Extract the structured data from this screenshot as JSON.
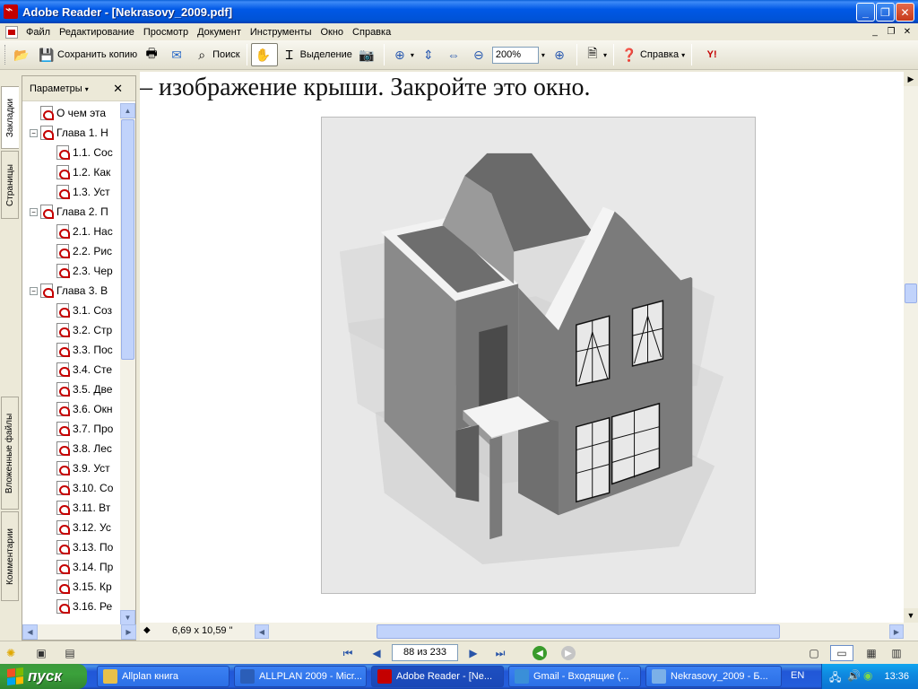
{
  "window": {
    "title": "Adobe Reader - [Nekrasovy_2009.pdf]"
  },
  "menu": {
    "items": [
      "Файл",
      "Редактирование",
      "Просмотр",
      "Документ",
      "Инструменты",
      "Окно",
      "Справка"
    ]
  },
  "toolbar": {
    "save_copy": "Сохранить копию",
    "search": "Поиск",
    "select": "Выделение",
    "zoom_value": "200%",
    "help": "Справка"
  },
  "side_tabs": {
    "bookmarks": "Закладки",
    "pages": "Страницы",
    "attachments": "Вложенные файлы",
    "comments": "Комментарии"
  },
  "bookmarks_panel": {
    "options_label": "Параметры",
    "items": [
      {
        "label": "О чем эта",
        "level": 0,
        "expander": ""
      },
      {
        "label": "Глава 1. Н",
        "level": 0,
        "expander": "−"
      },
      {
        "label": "1.1. Сос",
        "level": 1,
        "expander": ""
      },
      {
        "label": "1.2. Как",
        "level": 1,
        "expander": ""
      },
      {
        "label": "1.3. Уст",
        "level": 1,
        "expander": ""
      },
      {
        "label": "Глава 2. П",
        "level": 0,
        "expander": "−"
      },
      {
        "label": "2.1. Нас",
        "level": 1,
        "expander": ""
      },
      {
        "label": "2.2. Рис",
        "level": 1,
        "expander": ""
      },
      {
        "label": "2.3. Чер",
        "level": 1,
        "expander": ""
      },
      {
        "label": "Глава 3. В",
        "level": 0,
        "expander": "−"
      },
      {
        "label": "3.1. Соз",
        "level": 1,
        "expander": ""
      },
      {
        "label": "3.2. Стр",
        "level": 1,
        "expander": ""
      },
      {
        "label": "3.3. Пос",
        "level": 1,
        "expander": ""
      },
      {
        "label": "3.4. Сте",
        "level": 1,
        "expander": ""
      },
      {
        "label": "3.5. Две",
        "level": 1,
        "expander": ""
      },
      {
        "label": "3.6. Окн",
        "level": 1,
        "expander": ""
      },
      {
        "label": "3.7. Про",
        "level": 1,
        "expander": ""
      },
      {
        "label": "3.8. Лес",
        "level": 1,
        "expander": ""
      },
      {
        "label": "3.9. Уст",
        "level": 1,
        "expander": ""
      },
      {
        "label": "3.10. Со",
        "level": 1,
        "expander": ""
      },
      {
        "label": "3.11. Вт",
        "level": 1,
        "expander": ""
      },
      {
        "label": "3.12. Ус",
        "level": 1,
        "expander": ""
      },
      {
        "label": "3.13. По",
        "level": 1,
        "expander": ""
      },
      {
        "label": "3.14. Пр",
        "level": 1,
        "expander": ""
      },
      {
        "label": "3.15. Кр",
        "level": 1,
        "expander": ""
      },
      {
        "label": "3.16. Ре",
        "level": 1,
        "expander": ""
      }
    ]
  },
  "document": {
    "text_line": "– изображение крыши. Закройте это окно.",
    "page_size": "6,69 x 10,59 \""
  },
  "navigation": {
    "page_indicator": "88 из 233"
  },
  "taskbar": {
    "start_label": "пуск",
    "tasks": [
      {
        "label": "Allplan книга",
        "color": "#e8c04a"
      },
      {
        "label": "ALLPLAN 2009 - Micr...",
        "color": "#2b5eb8"
      },
      {
        "label": "Adobe Reader - [Ne...",
        "color": "#c40000"
      },
      {
        "label": "Gmail - Входящие (...",
        "color": "#3a8fd8"
      },
      {
        "label": "Nekrasovy_2009 - Б...",
        "color": "#7bb0e8"
      }
    ],
    "language": "EN",
    "clock": "13:36"
  }
}
